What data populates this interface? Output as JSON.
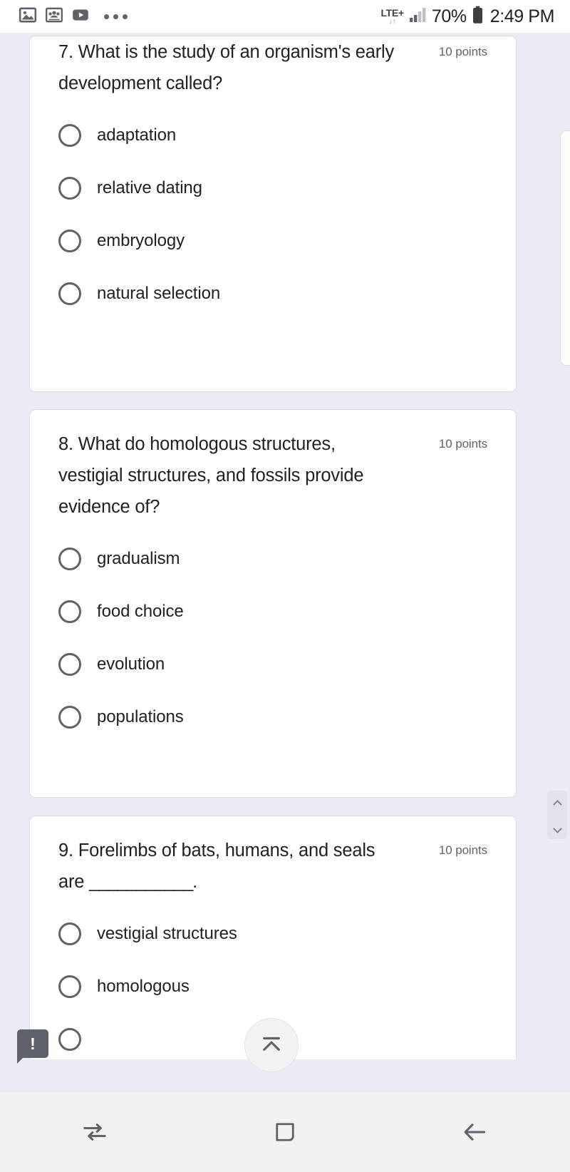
{
  "status_bar": {
    "notification_icons": [
      "image-icon",
      "group-photo-icon",
      "youtube-play-icon",
      "more-dots-icon"
    ],
    "network_label": "LTE+",
    "network_arrows": "↓↑",
    "signal_icon": "signal-bars-icon",
    "battery_percent": "70%",
    "battery_icon": "battery-icon",
    "time": "2:49 PM"
  },
  "questions": [
    {
      "title": "7. What is the study of an organism's early development called?",
      "points": "10 points",
      "options": [
        "adaptation",
        "relative dating",
        "embryology",
        "natural selection"
      ]
    },
    {
      "title": "8. What do homologous structures, vestigial structures, and fossils provide evidence of?",
      "points": "10 points",
      "options": [
        "gradualism",
        "food choice",
        "evolution",
        "populations"
      ]
    },
    {
      "title_part1": "9. Forelimbs of bats, humans, and seals are ",
      "title_blank": "___________",
      "title_part2": ".",
      "points": "10 points",
      "options": [
        "vestigial structures",
        "homologous"
      ]
    }
  ],
  "controls": {
    "scroll_up_label": "scroll-up",
    "scroll_down_label": "scroll-down",
    "scroll_to_top_icon": "scroll-to-top-icon",
    "alert_badge_text": "!"
  },
  "nav_bar": {
    "recents_icon": "recents-icon",
    "home_icon": "home-icon",
    "back_icon": "back-arrow-icon"
  },
  "colors": {
    "page_background": "#eceaf4",
    "card_background": "#ffffff",
    "card_border": "#dadce0",
    "text_primary": "#202124",
    "text_secondary": "#5f6368",
    "nav_background": "#f1f1f1",
    "badge_background": "#5f6269"
  }
}
